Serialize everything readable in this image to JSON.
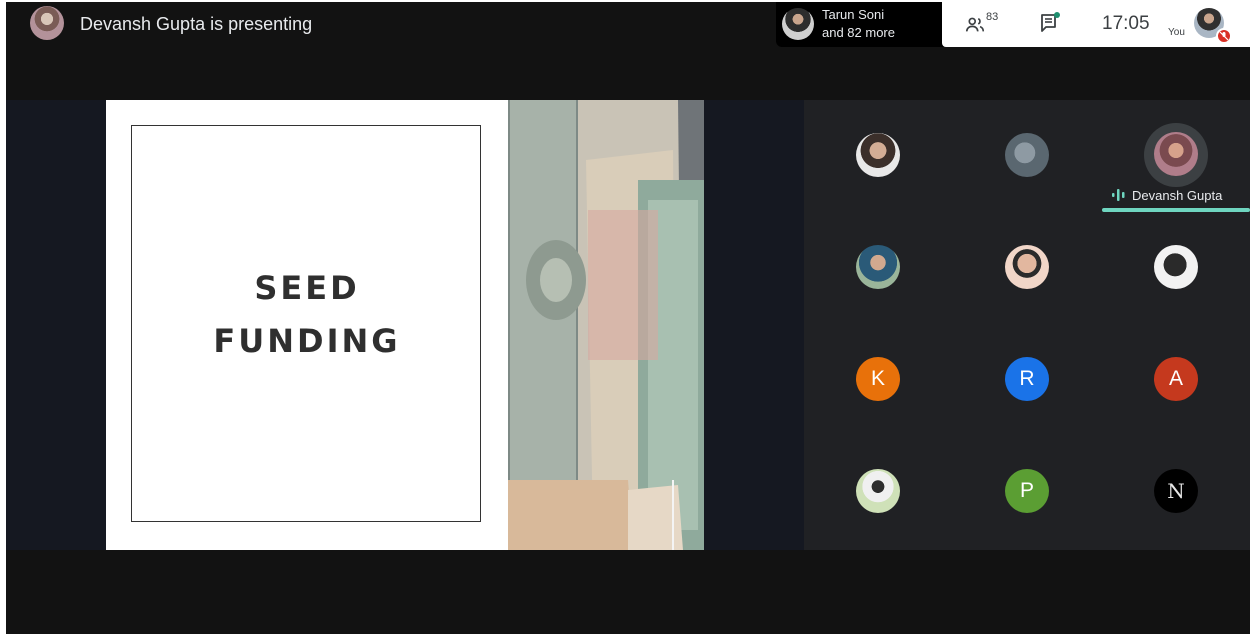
{
  "presenter": {
    "text": "Devansh Gupta is presenting"
  },
  "participants_chip": {
    "name": "Tarun Soni",
    "more": "and 82 more"
  },
  "controls": {
    "people_count": "83",
    "time": "17:05",
    "you_label": "You",
    "icons": [
      "people-icon",
      "chat-icon",
      "mic-off-icon"
    ]
  },
  "slide": {
    "title_line1": "SEED",
    "title_line2": "FUNDING"
  },
  "tiles": [
    {
      "type": "photo"
    },
    {
      "type": "photo"
    },
    {
      "type": "photo",
      "speaking": true,
      "name": "Devansh Gupta"
    },
    {
      "type": "photo"
    },
    {
      "type": "photo"
    },
    {
      "type": "photo"
    },
    {
      "type": "initial",
      "initial": "K",
      "color": "#e8710a"
    },
    {
      "type": "initial",
      "initial": "R",
      "color": "#1a73e8"
    },
    {
      "type": "initial",
      "initial": "A",
      "color": "#c5391e"
    },
    {
      "type": "photo"
    },
    {
      "type": "initial",
      "initial": "P",
      "color": "#5b9e33"
    },
    {
      "type": "logo",
      "initial": "N",
      "color": "#000000"
    }
  ],
  "colors": {
    "speaking_accent": "#6fd6c0",
    "mute_red": "#d93025"
  }
}
